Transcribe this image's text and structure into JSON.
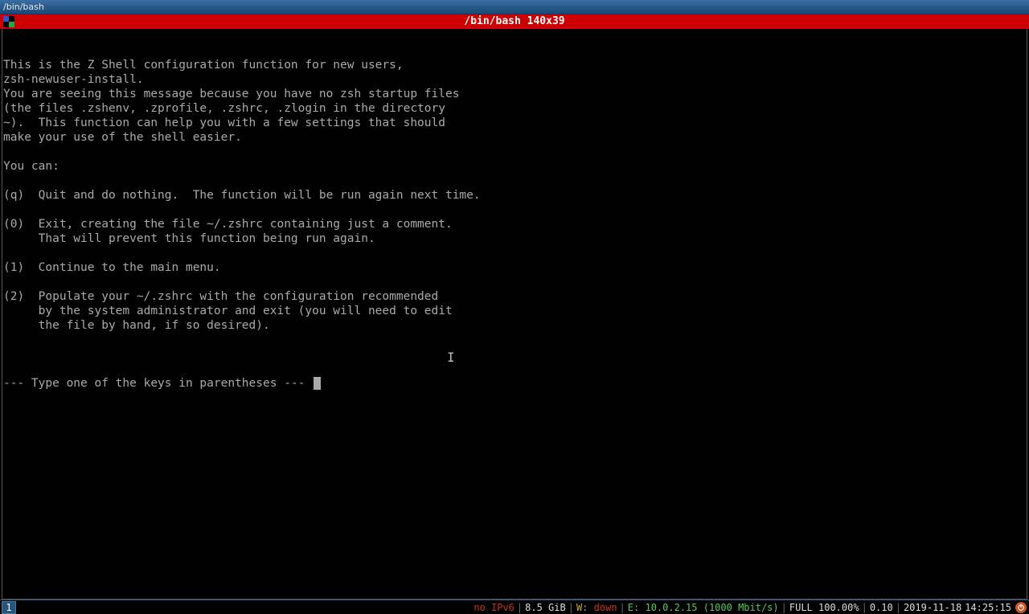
{
  "window": {
    "title": "/bin/bash"
  },
  "term_header": {
    "title": "/bin/bash 140x39"
  },
  "terminal": {
    "lines": [
      "This is the Z Shell configuration function for new users,",
      "zsh-newuser-install.",
      "You are seeing this message because you have no zsh startup files",
      "(the files .zshenv, .zprofile, .zshrc, .zlogin in the directory",
      "~).  This function can help you with a few settings that should",
      "make your use of the shell easier.",
      "",
      "You can:",
      "",
      "(q)  Quit and do nothing.  The function will be run again next time.",
      "",
      "(0)  Exit, creating the file ~/.zshrc containing just a comment.",
      "     That will prevent this function being run again.",
      "",
      "(1)  Continue to the main menu.",
      "",
      "(2)  Populate your ~/.zshrc with the configuration recommended",
      "     by the system administrator and exit (you will need to edit",
      "     the file by hand, if so desired).",
      ""
    ],
    "prompt": "--- Type one of the keys in parentheses --- "
  },
  "statusbar": {
    "workspace": "1",
    "ipv6": "no IPv6",
    "memory": "8.5 GiB",
    "wlan_label": "W:",
    "wlan_status": "down",
    "eth_label": "E:",
    "eth_ip": "10.0.2.15 (1000 Mbit/s)",
    "disk": "FULL 100.00%",
    "load": "0.10",
    "date": "2019-11-18",
    "time": "14:25:15"
  }
}
